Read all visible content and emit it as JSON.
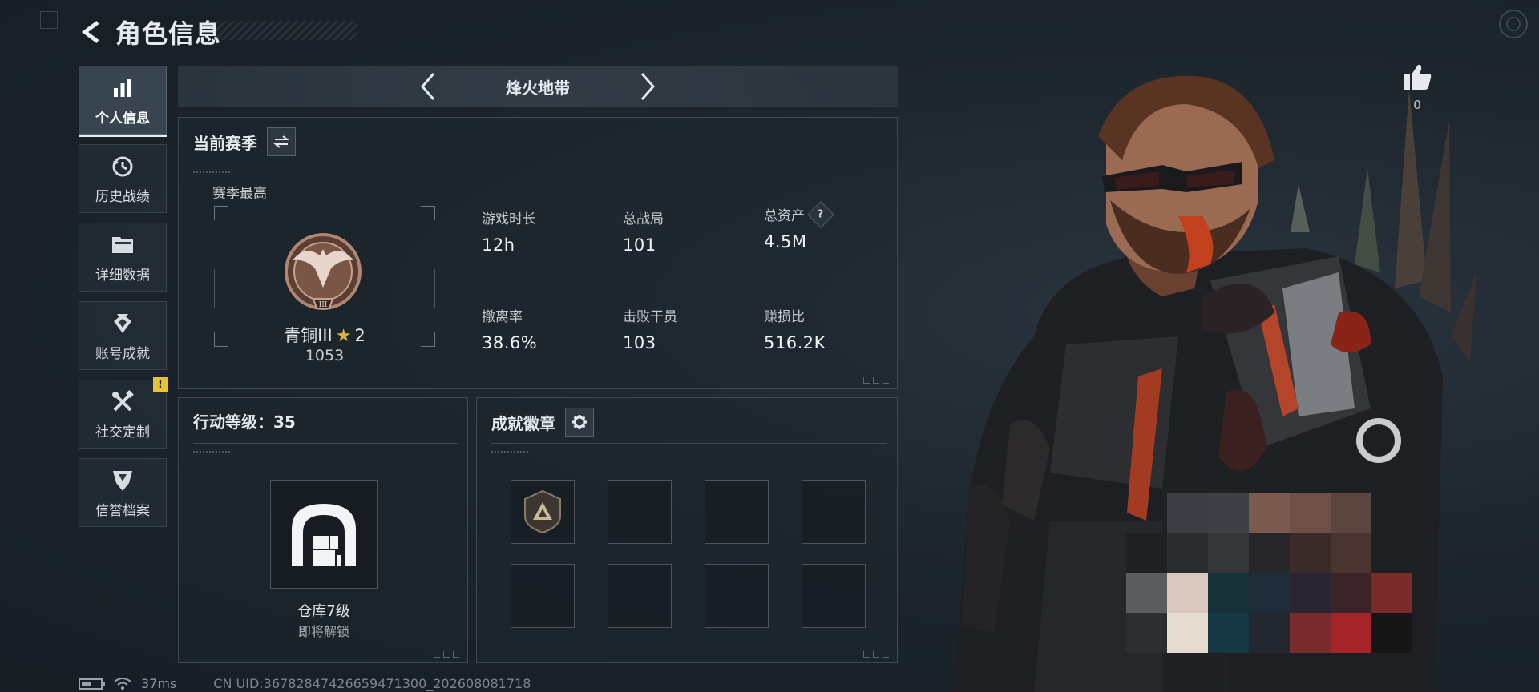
{
  "header": {
    "title": "角色信息",
    "back_icon": "back-arrow-icon"
  },
  "sidebar": {
    "items": [
      {
        "label": "个人信息",
        "icon": "bar-chart-icon",
        "active": true
      },
      {
        "label": "历史战绩",
        "icon": "history-clock-icon",
        "active": false
      },
      {
        "label": "详细数据",
        "icon": "folder-icon",
        "active": false
      },
      {
        "label": "账号成就",
        "icon": "achievement-icon",
        "active": false
      },
      {
        "label": "社交定制",
        "icon": "tools-icon",
        "active": false,
        "alert": "!"
      },
      {
        "label": "信誉档案",
        "icon": "reputation-shield-icon",
        "active": false
      }
    ]
  },
  "mode": {
    "name": "烽火地带"
  },
  "season": {
    "title": "当前赛季",
    "best_label": "赛季最高",
    "rank_name": "青铜III",
    "rank_star_icon": "star-icon",
    "rank_stars": "2",
    "rank_score": "1053",
    "rank_emblem_tier": "III",
    "stats": [
      {
        "label": "游戏时长",
        "value": "12h"
      },
      {
        "label": "总战局",
        "value": "101"
      },
      {
        "label": "总资产",
        "value": "4.5M",
        "help": "?"
      },
      {
        "label": "撤离率",
        "value": "38.6%"
      },
      {
        "label": "击败干员",
        "value": "103"
      },
      {
        "label": "赚损比",
        "value": "516.2K"
      }
    ]
  },
  "level": {
    "title": "行动等级：35",
    "unlock_name": "仓库7级",
    "unlock_sub": "即将解锁"
  },
  "badges": {
    "title": "成就徽章",
    "settings_icon": "gear-icon",
    "slots": [
      "triangle-badge",
      "",
      "",
      "",
      "",
      "",
      "",
      ""
    ]
  },
  "character": {
    "likes": "0",
    "like_icon": "thumbs-up-icon"
  },
  "footer": {
    "ping": "37ms",
    "uid": "CN UID:3678284742665947130​0_202608081718"
  },
  "colors": {
    "accent_gold": "#d9b14a",
    "alert_yellow": "#e7c13a",
    "bronze": "#a0705a"
  }
}
